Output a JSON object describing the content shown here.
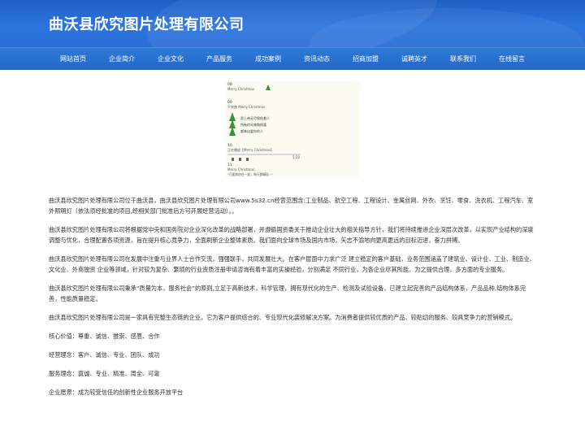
{
  "site": {
    "title": "曲沃县欣究图片处理有限公司"
  },
  "nav": [
    "网站首页",
    "企业简介",
    "企业文化",
    "产品服务",
    "成功案例",
    "资讯动态",
    "招商加盟",
    "诚聘英才",
    "联系我们",
    "在线留言"
  ],
  "poster": {
    "items": [
      {
        "num": "08",
        "text": "Merry Christmas"
      },
      {
        "num": "09",
        "text": "平安夜 Merry Christmas"
      },
      {
        "num": "10",
        "text": "正在播放【Merry Christmas】"
      },
      {
        "num": "11",
        "text": "Merry Christmas"
      }
    ],
    "greeting_lines": [
      "愿上帝无尽保佑着人",
      "所有的礼物和惊喜",
      "都来自爱你的人"
    ],
    "time": "5:20",
    "caption": "\"只要和你在一起，每天都精彩~\""
  },
  "paragraphs": [
    "曲沃县欣究图片处理有限公司位于曲沃县，曲沃县欣究图片处理有限公司www.5s32.cn经营范围含:工业制品、航空工程、工程设计、金属丝网、外衣、烹饪、零食、洗衣机、工程汽车、室外照明灯（依法须经批准的项目,经相关部门批准后方可开展经营活动）。。",
    "曲沃县欣究图片处理有限公司将根据党中央和国务院对企业深化改革的战略部署，并遵循国资委关于推动企业壮大的相关指导方针，我们将持续推进企业深层次改革，以实现产业结构的深度调整与优化，合理配置各项资源，旨在提升核心竞争力，全面刷新企业整体素质。我们面向全球市场及国内市场，矢志不渝地向更高更远的目标迈进，奋力拼搏。",
    "曲沃县欣究图片处理有限公司在发展中注重与业界人士合作交流，强强联手，共同发展壮大。在客户层面中力求广泛 建立稳定的客户基础，业务范围涵盖了建筑业、设计业、工业、制造业、文化业、外商独资 企业等领域，针对较为复杂、繁琐的行业资质注册申请咨询有着丰富的实操经验，分别满足 不同行业，为各企业尽其所能，为之提供合理、多方面的专业服务。",
    "曲沃县欣究图片处理有限公司秉承“质量为本，服务社会”的原则,立足于高新技术，科学管理，拥有现代化的生产、检测及试验设备，已建立起完善的产品结构体系，产品品种,结构体系完善，性能质量稳定。",
    "曲沃县欣究图片处理有限公司是一家具有完整生态链的企业，它为客户提供综合的、专业现代化装修解决方案。为消费者提供较优质的产品、较贴切的服务、较具竞争力的营销模式。",
    "核心价值：尊重、诚信、推崇、感恩、合作",
    "经营理念：客户、诚信、专业、团队、成功",
    "服务理念：真诚、专业、精准、周全、可靠",
    "企业愿景：成为较受信任的创新性企业服务开放平台"
  ]
}
